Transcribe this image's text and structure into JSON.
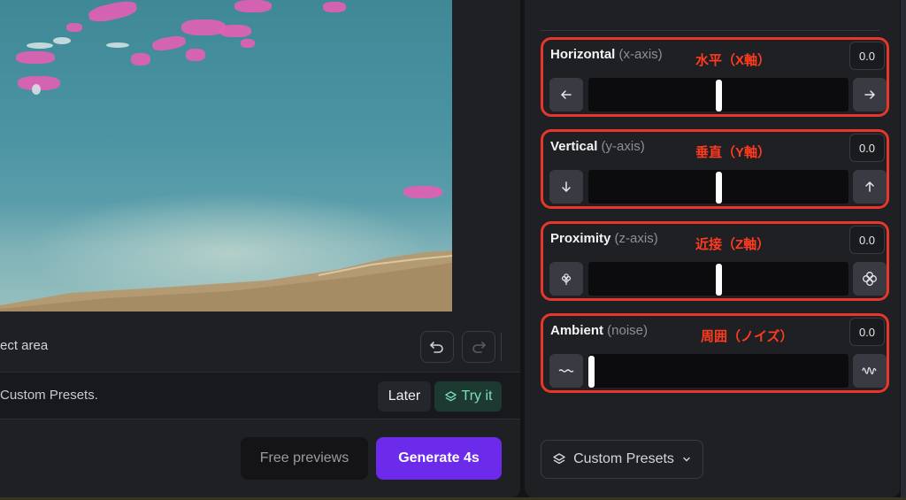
{
  "toolbar": {
    "select_area_label": "ect area",
    "undo_icon": "undo-icon",
    "redo_icon": "redo-icon"
  },
  "preset_banner": {
    "text": "Custom Presets.",
    "later_label": "Later",
    "try_label": "Try it",
    "try_icon": "layers-icon"
  },
  "actions": {
    "free_previews_label": "Free previews",
    "generate_label": "Generate 4s"
  },
  "sliders": [
    {
      "title": "Horizontal",
      "subtitle": "(x-axis)",
      "note": "水平（X軸）",
      "value": "0.0",
      "left_icon": "arrow-left-icon",
      "right_icon": "arrow-right-icon",
      "position": 0.5
    },
    {
      "title": "Vertical",
      "subtitle": "(y-axis)",
      "note": "垂直（Y軸）",
      "value": "0.0",
      "left_icon": "arrow-down-icon",
      "right_icon": "arrow-up-icon",
      "position": 0.5
    },
    {
      "title": "Proximity",
      "subtitle": "(z-axis)",
      "note": "近接（Z軸）",
      "value": "0.0",
      "left_icon": "flower-small-icon",
      "right_icon": "flower-large-icon",
      "position": 0.5
    },
    {
      "title": "Ambient",
      "subtitle": "(noise)",
      "note": "周囲（ノイズ）",
      "value": "0.0",
      "left_icon": "wave-low-icon",
      "right_icon": "wave-high-icon",
      "position": 0.0
    }
  ],
  "presets_dropdown": {
    "label": "Custom Presets",
    "icon": "layers-icon",
    "chevron": "chevron-down-icon"
  },
  "colors": {
    "accent": "#6c2bea",
    "annotation": "#e7372a",
    "try_it": "#7fe0b8"
  }
}
